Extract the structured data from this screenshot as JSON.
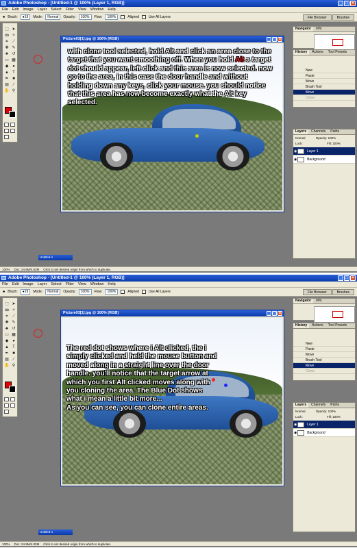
{
  "app": {
    "title": "Adobe Photoshop - [Untitled-1 @ 100% (Layer 1, RGB)]",
    "menus": [
      "File",
      "Edit",
      "Image",
      "Layer",
      "Select",
      "Filter",
      "View",
      "Window",
      "Help"
    ],
    "options": {
      "brush_label": "Brush:",
      "mode_label": "Mode:",
      "mode_value": "Normal",
      "opacity_label": "Opacity:",
      "opacity_value": "100%",
      "flow_label": "Flow:",
      "flow_value": "100%",
      "aligned_label": "Aligned",
      "use_all_layers_label": "Use All Layers",
      "file_browser_tab": "File Browser",
      "brushes_tab": "Brushes"
    },
    "statusbar": {
      "zoom": "100%",
      "doc": "Doc: 24.9M/4.02M",
      "hint": "Click to set desired origin from which to duplicate."
    },
    "minimized_doc": "Untitled-1",
    "colors": {
      "foreground": "#e00000",
      "background": "#000000",
      "titlebar": "#0b3aa8",
      "canvas_bg": "#7a7a7a"
    }
  },
  "panels": {
    "navigator_tabs": [
      "Navigator",
      "Info"
    ],
    "history_tabs": [
      "History",
      "Actions",
      "Tool Presets"
    ],
    "history_items": [
      "New",
      "Paste",
      "Move",
      "Brush Tool",
      "Move",
      "Clone"
    ],
    "layers_tabs": [
      "Layers",
      "Channels",
      "Paths"
    ],
    "blend_mode": "Normal",
    "opacity_label": "Opacity:",
    "opacity_value": "100%",
    "lock_label": "Lock:",
    "fill_label": "Fill:",
    "fill_value": "100%",
    "layers": [
      "Layer 1",
      "Background"
    ]
  },
  "screens": [
    {
      "doc_title": "Picture03[1].jpg @ 100% (RGB)",
      "instruction_before": "with clone tool selected, hold Alt and click an area close to the target that you want smoothing off. When you hold ",
      "instruction_highlight": "Alt",
      "instruction_after": " a target dot should appear, left click and this area is now selected. now go to the area, in this case the door handle and without holding down any keys, click your mouse. you should notice that this area has now become exactly what the Alt key selected."
    },
    {
      "doc_title": "Picture03[1].jpg @ 100% (RGB)",
      "instruction": "The red dot shows where i Alt clicked, the i simply clicked and held the mouse button and moved along in a straight line over the door handle. you'll notice that the target arrow at which you first Alt clicked moves along with you cloning the area. The Blue Dot shows what i mean a little bit more...",
      "instruction2": "As you can see, you can clone entire areas."
    }
  ]
}
